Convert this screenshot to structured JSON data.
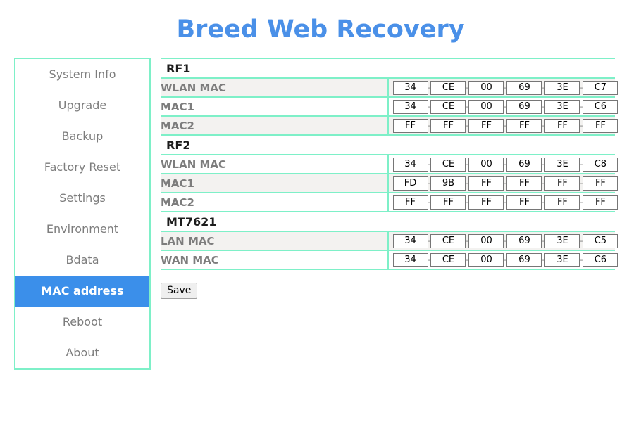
{
  "header": {
    "title": "Breed Web Recovery",
    "title_color": "#4a90e8"
  },
  "theme": {
    "accent_border": "#7ef0c8",
    "active_item_bg": "#3b8fea",
    "row_stripe_bg": "#f3f2f0",
    "label_text": "#7d7d7d"
  },
  "sidebar": {
    "items": [
      {
        "label": "System Info",
        "active": false
      },
      {
        "label": "Upgrade",
        "active": false
      },
      {
        "label": "Backup",
        "active": false
      },
      {
        "label": "Factory Reset",
        "active": false
      },
      {
        "label": "Settings",
        "active": false
      },
      {
        "label": "Environment",
        "active": false
      },
      {
        "label": "Bdata",
        "active": false
      },
      {
        "label": "MAC address",
        "active": true
      },
      {
        "label": "Reboot",
        "active": false
      },
      {
        "label": "About",
        "active": false
      }
    ]
  },
  "main": {
    "sections": [
      {
        "title": "RF1",
        "rows": [
          {
            "label": "WLAN MAC",
            "octets": [
              "34",
              "CE",
              "00",
              "69",
              "3E",
              "C7"
            ]
          },
          {
            "label": "MAC1",
            "octets": [
              "34",
              "CE",
              "00",
              "69",
              "3E",
              "C6"
            ]
          },
          {
            "label": "MAC2",
            "octets": [
              "FF",
              "FF",
              "FF",
              "FF",
              "FF",
              "FF"
            ]
          }
        ]
      },
      {
        "title": "RF2",
        "rows": [
          {
            "label": "WLAN MAC",
            "octets": [
              "34",
              "CE",
              "00",
              "69",
              "3E",
              "C8"
            ]
          },
          {
            "label": "MAC1",
            "octets": [
              "FD",
              "9B",
              "FF",
              "FF",
              "FF",
              "FF"
            ]
          },
          {
            "label": "MAC2",
            "octets": [
              "FF",
              "FF",
              "FF",
              "FF",
              "FF",
              "FF"
            ]
          }
        ]
      },
      {
        "title": "MT7621",
        "rows": [
          {
            "label": "LAN MAC",
            "octets": [
              "34",
              "CE",
              "00",
              "69",
              "3E",
              "C5"
            ]
          },
          {
            "label": "WAN MAC",
            "octets": [
              "34",
              "CE",
              "00",
              "69",
              "3E",
              "C6"
            ]
          }
        ]
      }
    ],
    "octet_separator": "-",
    "save_label": "Save"
  }
}
